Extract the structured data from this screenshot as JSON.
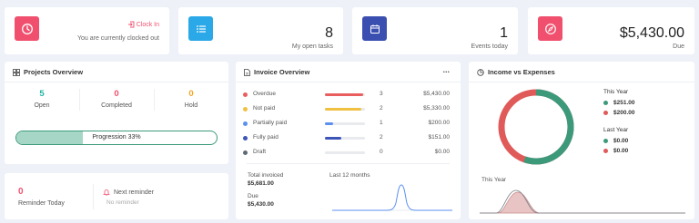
{
  "stat_cards": {
    "clock": {
      "action": "Clock In",
      "label": "You are currently clocked out"
    },
    "tasks": {
      "number": "8",
      "label": "My open tasks"
    },
    "events": {
      "number": "1",
      "label": "Events today"
    },
    "due": {
      "number": "$5,430.00",
      "label": "Due"
    }
  },
  "projects_overview": {
    "title": "Projects Overview",
    "stats": [
      {
        "value": "5",
        "label": "Open",
        "color": "#20b5a0"
      },
      {
        "value": "0",
        "label": "Completed",
        "color": "#f0506e"
      },
      {
        "value": "0",
        "label": "Hold",
        "color": "#f5a623"
      }
    ],
    "progress_label": "Progression 33%",
    "progress_value": 0.33
  },
  "reminders": {
    "count": "0",
    "count_label": "Reminder Today",
    "next_label": "Next reminder",
    "next_value": "No reminder"
  },
  "invoice_overview": {
    "title": "Invoice Overview",
    "menu": "...",
    "rows": [
      {
        "label": "Overdue",
        "count": "3",
        "amount": "$5,430.00",
        "color": "#e95e5e",
        "fill": 0.95
      },
      {
        "label": "Not paid",
        "count": "2",
        "amount": "$5,330.00",
        "color": "#f0c040",
        "fill": 0.9
      },
      {
        "label": "Partially paid",
        "count": "1",
        "amount": "$200.00",
        "color": "#5b8ff0",
        "fill": 0.2
      },
      {
        "label": "Fully paid",
        "count": "2",
        "amount": "$151.00",
        "color": "#3d55b8",
        "fill": 0.4
      },
      {
        "label": "Draft",
        "count": "0",
        "amount": "$0.00",
        "color": "#606a74",
        "fill": 0
      }
    ],
    "total_invoiced_label": "Total invoiced",
    "total_invoiced": "$5,681.00",
    "due_label": "Due",
    "due_value": "$5,430.00",
    "chart_label": "Last 12 months"
  },
  "income_expenses": {
    "title": "Income vs Expenses",
    "this_year_label": "This Year",
    "this_year_income": "$251.00",
    "this_year_expense": "$200.00",
    "last_year_label": "Last Year",
    "last_year_income": "$0.00",
    "last_year_expense": "$0.00",
    "chart_label": "This Year",
    "colors": {
      "income": "#3c9a7a",
      "expense": "#e05a5a"
    }
  }
}
